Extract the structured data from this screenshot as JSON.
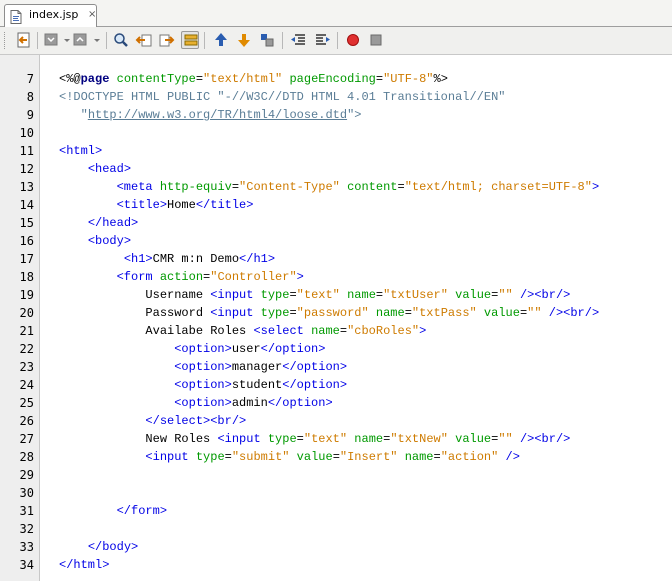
{
  "tab": {
    "file_name": "index.jsp",
    "close_glyph": "×"
  },
  "toolbar": {
    "icons": [
      "back-history-icon",
      "prev-edit-icon",
      "next-edit-icon",
      "find-icon",
      "find-previous-icon",
      "find-next-icon",
      "toggle-highlight-icon",
      "prev-bookmark-icon",
      "next-bookmark-icon",
      "toggle-bookmark-icon",
      "shift-left-icon",
      "shift-right-icon",
      "start-macro-icon",
      "stop-macro-icon"
    ]
  },
  "colors": {
    "tag": "#0000e6",
    "attribute": "#009900",
    "value": "#ce7b00",
    "directive": "#000080",
    "doctype": "#5a7d96"
  },
  "editor": {
    "lines": [
      {
        "n": "7",
        "segs": [
          [
            "t",
            "<%@"
          ],
          [
            "k",
            "page"
          ],
          [
            "t",
            " "
          ],
          [
            "a",
            "contentType"
          ],
          [
            "t",
            "="
          ],
          [
            "v",
            "\"text/html\""
          ],
          [
            "t",
            " "
          ],
          [
            "a",
            "pageEncoding"
          ],
          [
            "t",
            "="
          ],
          [
            "v",
            "\"UTF-8\""
          ],
          [
            "t",
            "%>"
          ]
        ]
      },
      {
        "n": "8",
        "segs": [
          [
            "d",
            "<!DOCTYPE HTML PUBLIC \"-//W3C//DTD HTML 4.01 Transitional//EN\""
          ]
        ]
      },
      {
        "n": "9",
        "segs": [
          [
            "d",
            "   \""
          ],
          [
            "u",
            "http://www.w3.org/TR/html4/loose.dtd"
          ],
          [
            "d",
            "\">"
          ]
        ]
      },
      {
        "n": "10",
        "segs": []
      },
      {
        "n": "11",
        "segs": [
          [
            "g",
            "<html>"
          ]
        ]
      },
      {
        "n": "12",
        "segs": [
          [
            "t",
            "    "
          ],
          [
            "g",
            "<head>"
          ]
        ]
      },
      {
        "n": "13",
        "segs": [
          [
            "t",
            "        "
          ],
          [
            "g",
            "<meta"
          ],
          [
            "t",
            " "
          ],
          [
            "a",
            "http-equiv"
          ],
          [
            "t",
            "="
          ],
          [
            "v",
            "\"Content-Type\""
          ],
          [
            "t",
            " "
          ],
          [
            "a",
            "content"
          ],
          [
            "t",
            "="
          ],
          [
            "v",
            "\"text/html; charset=UTF-8\""
          ],
          [
            "g",
            ">"
          ]
        ]
      },
      {
        "n": "14",
        "segs": [
          [
            "t",
            "        "
          ],
          [
            "g",
            "<title>"
          ],
          [
            "t",
            "Home"
          ],
          [
            "g",
            "</title>"
          ]
        ]
      },
      {
        "n": "15",
        "segs": [
          [
            "t",
            "    "
          ],
          [
            "g",
            "</head>"
          ]
        ]
      },
      {
        "n": "16",
        "segs": [
          [
            "t",
            "    "
          ],
          [
            "g",
            "<body>"
          ]
        ]
      },
      {
        "n": "17",
        "segs": [
          [
            "t",
            "         "
          ],
          [
            "g",
            "<h1>"
          ],
          [
            "t",
            "CMR m:n Demo"
          ],
          [
            "g",
            "</h1>"
          ]
        ]
      },
      {
        "n": "18",
        "segs": [
          [
            "t",
            "        "
          ],
          [
            "g",
            "<form"
          ],
          [
            "t",
            " "
          ],
          [
            "a",
            "action"
          ],
          [
            "t",
            "="
          ],
          [
            "v",
            "\"Controller\""
          ],
          [
            "g",
            ">"
          ]
        ]
      },
      {
        "n": "19",
        "segs": [
          [
            "t",
            "            Username "
          ],
          [
            "g",
            "<input"
          ],
          [
            "t",
            " "
          ],
          [
            "a",
            "type"
          ],
          [
            "t",
            "="
          ],
          [
            "v",
            "\"text\""
          ],
          [
            "t",
            " "
          ],
          [
            "a",
            "name"
          ],
          [
            "t",
            "="
          ],
          [
            "v",
            "\"txtUser\""
          ],
          [
            "t",
            " "
          ],
          [
            "a",
            "value"
          ],
          [
            "t",
            "="
          ],
          [
            "v",
            "\"\""
          ],
          [
            "t",
            " "
          ],
          [
            "g",
            "/><br/>"
          ]
        ]
      },
      {
        "n": "20",
        "segs": [
          [
            "t",
            "            Password "
          ],
          [
            "g",
            "<input"
          ],
          [
            "t",
            " "
          ],
          [
            "a",
            "type"
          ],
          [
            "t",
            "="
          ],
          [
            "v",
            "\"password\""
          ],
          [
            "t",
            " "
          ],
          [
            "a",
            "name"
          ],
          [
            "t",
            "="
          ],
          [
            "v",
            "\"txtPass\""
          ],
          [
            "t",
            " "
          ],
          [
            "a",
            "value"
          ],
          [
            "t",
            "="
          ],
          [
            "v",
            "\"\""
          ],
          [
            "t",
            " "
          ],
          [
            "g",
            "/><br/>"
          ]
        ]
      },
      {
        "n": "21",
        "segs": [
          [
            "t",
            "            Availabe Roles "
          ],
          [
            "g",
            "<select"
          ],
          [
            "t",
            " "
          ],
          [
            "a",
            "name"
          ],
          [
            "t",
            "="
          ],
          [
            "v",
            "\"cboRoles\""
          ],
          [
            "g",
            ">"
          ]
        ]
      },
      {
        "n": "22",
        "segs": [
          [
            "t",
            "                "
          ],
          [
            "g",
            "<option>"
          ],
          [
            "t",
            "user"
          ],
          [
            "g",
            "</option>"
          ]
        ]
      },
      {
        "n": "23",
        "segs": [
          [
            "t",
            "                "
          ],
          [
            "g",
            "<option>"
          ],
          [
            "t",
            "manager"
          ],
          [
            "g",
            "</option>"
          ]
        ]
      },
      {
        "n": "24",
        "segs": [
          [
            "t",
            "                "
          ],
          [
            "g",
            "<option>"
          ],
          [
            "t",
            "student"
          ],
          [
            "g",
            "</option>"
          ]
        ]
      },
      {
        "n": "25",
        "segs": [
          [
            "t",
            "                "
          ],
          [
            "g",
            "<option>"
          ],
          [
            "t",
            "admin"
          ],
          [
            "g",
            "</option>"
          ]
        ]
      },
      {
        "n": "26",
        "segs": [
          [
            "t",
            "            "
          ],
          [
            "g",
            "</select><br/>"
          ]
        ]
      },
      {
        "n": "27",
        "segs": [
          [
            "t",
            "            New Roles "
          ],
          [
            "g",
            "<input"
          ],
          [
            "t",
            " "
          ],
          [
            "a",
            "type"
          ],
          [
            "t",
            "="
          ],
          [
            "v",
            "\"text\""
          ],
          [
            "t",
            " "
          ],
          [
            "a",
            "name"
          ],
          [
            "t",
            "="
          ],
          [
            "v",
            "\"txtNew\""
          ],
          [
            "t",
            " "
          ],
          [
            "a",
            "value"
          ],
          [
            "t",
            "="
          ],
          [
            "v",
            "\"\""
          ],
          [
            "t",
            " "
          ],
          [
            "g",
            "/><br/>"
          ]
        ]
      },
      {
        "n": "28",
        "segs": [
          [
            "t",
            "            "
          ],
          [
            "g",
            "<input"
          ],
          [
            "t",
            " "
          ],
          [
            "a",
            "type"
          ],
          [
            "t",
            "="
          ],
          [
            "v",
            "\"submit\""
          ],
          [
            "t",
            " "
          ],
          [
            "a",
            "value"
          ],
          [
            "t",
            "="
          ],
          [
            "v",
            "\"Insert\""
          ],
          [
            "t",
            " "
          ],
          [
            "a",
            "name"
          ],
          [
            "t",
            "="
          ],
          [
            "v",
            "\"action\""
          ],
          [
            "t",
            " "
          ],
          [
            "g",
            "/>"
          ]
        ]
      },
      {
        "n": "29",
        "segs": []
      },
      {
        "n": "30",
        "segs": []
      },
      {
        "n": "31",
        "segs": [
          [
            "t",
            "        "
          ],
          [
            "g",
            "</form>"
          ]
        ]
      },
      {
        "n": "32",
        "segs": []
      },
      {
        "n": "33",
        "segs": [
          [
            "t",
            "    "
          ],
          [
            "g",
            "</body>"
          ]
        ]
      },
      {
        "n": "34",
        "segs": [
          [
            "g",
            "</html>"
          ]
        ]
      }
    ]
  }
}
